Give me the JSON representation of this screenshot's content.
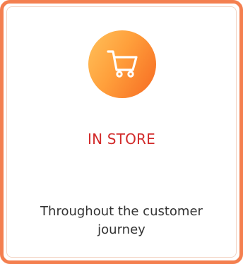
{
  "card": {
    "icon": "shopping-cart-icon",
    "title": "IN STORE",
    "description": "Throughout the customer journey"
  },
  "colors": {
    "border": "#f47f4f",
    "title": "#d22a2a",
    "icon_gradient_start": "#ffc15a",
    "icon_gradient_end": "#f66a22"
  }
}
